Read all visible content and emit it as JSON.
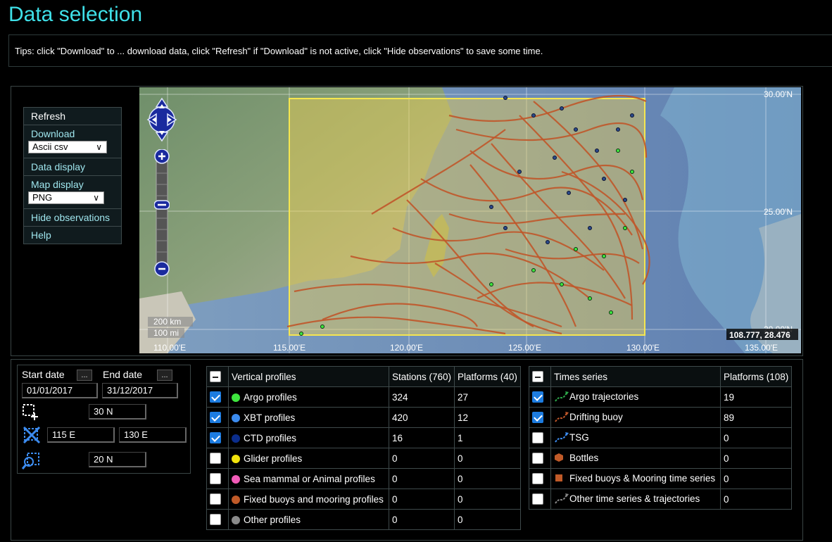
{
  "page": {
    "title": "Data selection",
    "tips": "Tips: click \"Download\" to ... download data, click \"Refresh\" if \"Download\" is not active, click \"Hide observations\" to save some time."
  },
  "menu": {
    "refresh": "Refresh",
    "download": "Download",
    "download_format": "Ascii csv",
    "data_display": "Data display",
    "map_display": "Map display",
    "map_format": "PNG",
    "hide_observations": "Hide observations",
    "help": "Help"
  },
  "map": {
    "scale_km": "200 km",
    "scale_mi": "100 mi",
    "coords": "108.777, 28.476",
    "lat_labels": [
      "30.00'N",
      "25.00'N",
      "20.00'N"
    ],
    "lon_labels": [
      "110.00'E",
      "115.00'E",
      "120.00'E",
      "125.00'E",
      "130.00'E",
      "135.00'E"
    ]
  },
  "dates": {
    "start_label": "Start date",
    "end_label": "End date",
    "start_value": "01/01/2017",
    "end_value": "31/12/2017",
    "btn": "...",
    "north": "30 N",
    "west": "115 E",
    "east": "130 E",
    "south": "20 N"
  },
  "vertical": {
    "header": "Vertical profiles",
    "col_stations": "Stations (760)",
    "col_platforms": "Platforms (40)",
    "rows": [
      {
        "name": "Argo profiles",
        "stations": "324",
        "platforms": "27",
        "checked": true,
        "color": "#3ee63e"
      },
      {
        "name": "XBT profiles",
        "stations": "420",
        "platforms": "12",
        "checked": true,
        "color": "#3c8cf0"
      },
      {
        "name": "CTD profiles",
        "stations": "16",
        "platforms": "1",
        "checked": true,
        "color": "#0b2d8c"
      },
      {
        "name": "Glider profiles",
        "stations": "0",
        "platforms": "0",
        "checked": false,
        "color": "#f2e30c"
      },
      {
        "name": "Sea mammal or Animal profiles",
        "stations": "0",
        "platforms": "0",
        "checked": false,
        "color": "#f25bb8"
      },
      {
        "name": "Fixed buoys and mooring profiles",
        "stations": "0",
        "platforms": "0",
        "checked": false,
        "color": "#c05a28"
      },
      {
        "name": "Other profiles",
        "stations": "0",
        "platforms": "0",
        "checked": false,
        "color": "#8a8a8a"
      }
    ]
  },
  "timeseries": {
    "header": "Times series",
    "col_platforms": "Platforms (108)",
    "rows": [
      {
        "name": "Argo trajectories",
        "platforms": "19",
        "checked": true,
        "icon": "argo-trajectory-icon",
        "color": "#2da84a"
      },
      {
        "name": "Drifting buoy",
        "platforms": "89",
        "checked": true,
        "icon": "drifting-buoy-icon",
        "color": "#c0572a"
      },
      {
        "name": "TSG",
        "platforms": "0",
        "checked": false,
        "icon": "tsg-icon",
        "color": "#3c8cf0"
      },
      {
        "name": "Bottles",
        "platforms": "0",
        "checked": false,
        "icon": "bottles-icon",
        "color": "#c05a28"
      },
      {
        "name": "Fixed buoys & Mooring time series",
        "platforms": "0",
        "checked": false,
        "icon": "mooring-icon",
        "color": "#c05a28"
      },
      {
        "name": "Other time series & trajectories",
        "platforms": "0",
        "checked": false,
        "icon": "other-trajectory-icon",
        "color": "#888888"
      }
    ]
  }
}
